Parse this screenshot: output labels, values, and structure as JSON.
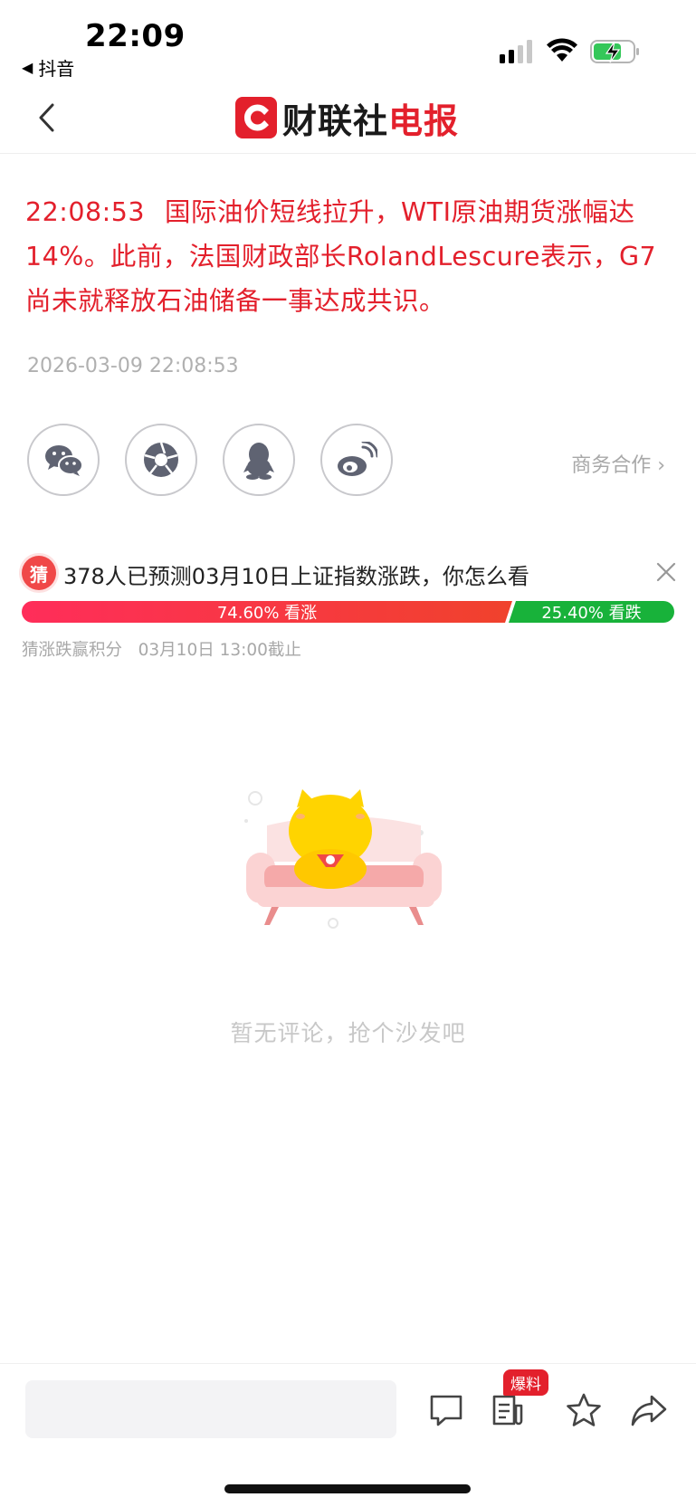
{
  "status_bar": {
    "time": "22:09",
    "back_app": "抖音"
  },
  "nav": {
    "logo_text_black": "财联社",
    "logo_text_red": "电报",
    "brand_color": "#e3202c"
  },
  "article": {
    "timestamp": "22:08:53",
    "content": "国际油价短线拉升，WTI原油期货涨幅达14%。此前，法国财政部长RolandLescure表示，G7尚未就释放石油储备一事达成共识。",
    "published": "2026-03-09 22:08:53"
  },
  "share": {
    "buttons": [
      "wechat-icon",
      "moments-icon",
      "qq-icon",
      "weibo-icon"
    ],
    "business_link": "商务合作 ›"
  },
  "prediction": {
    "badge": "猜",
    "title": "378人已预测03月10日上证指数涨跌，你怎么看",
    "up_label": "74.60% 看涨",
    "down_label": "25.40% 看跌",
    "up_ratio": 0.746,
    "subtitle": "猜涨跌赢积分   03月10日 13:00截止",
    "up_color": "#f0422c",
    "down_color": "#18b23a"
  },
  "comments": {
    "empty_text": "暂无评论，抢个沙发吧"
  },
  "bottom_bar": {
    "input_placeholder": "",
    "tip_badge": "爆料",
    "icons": [
      "comment-icon",
      "news-icon",
      "star-icon",
      "share-icon"
    ]
  }
}
